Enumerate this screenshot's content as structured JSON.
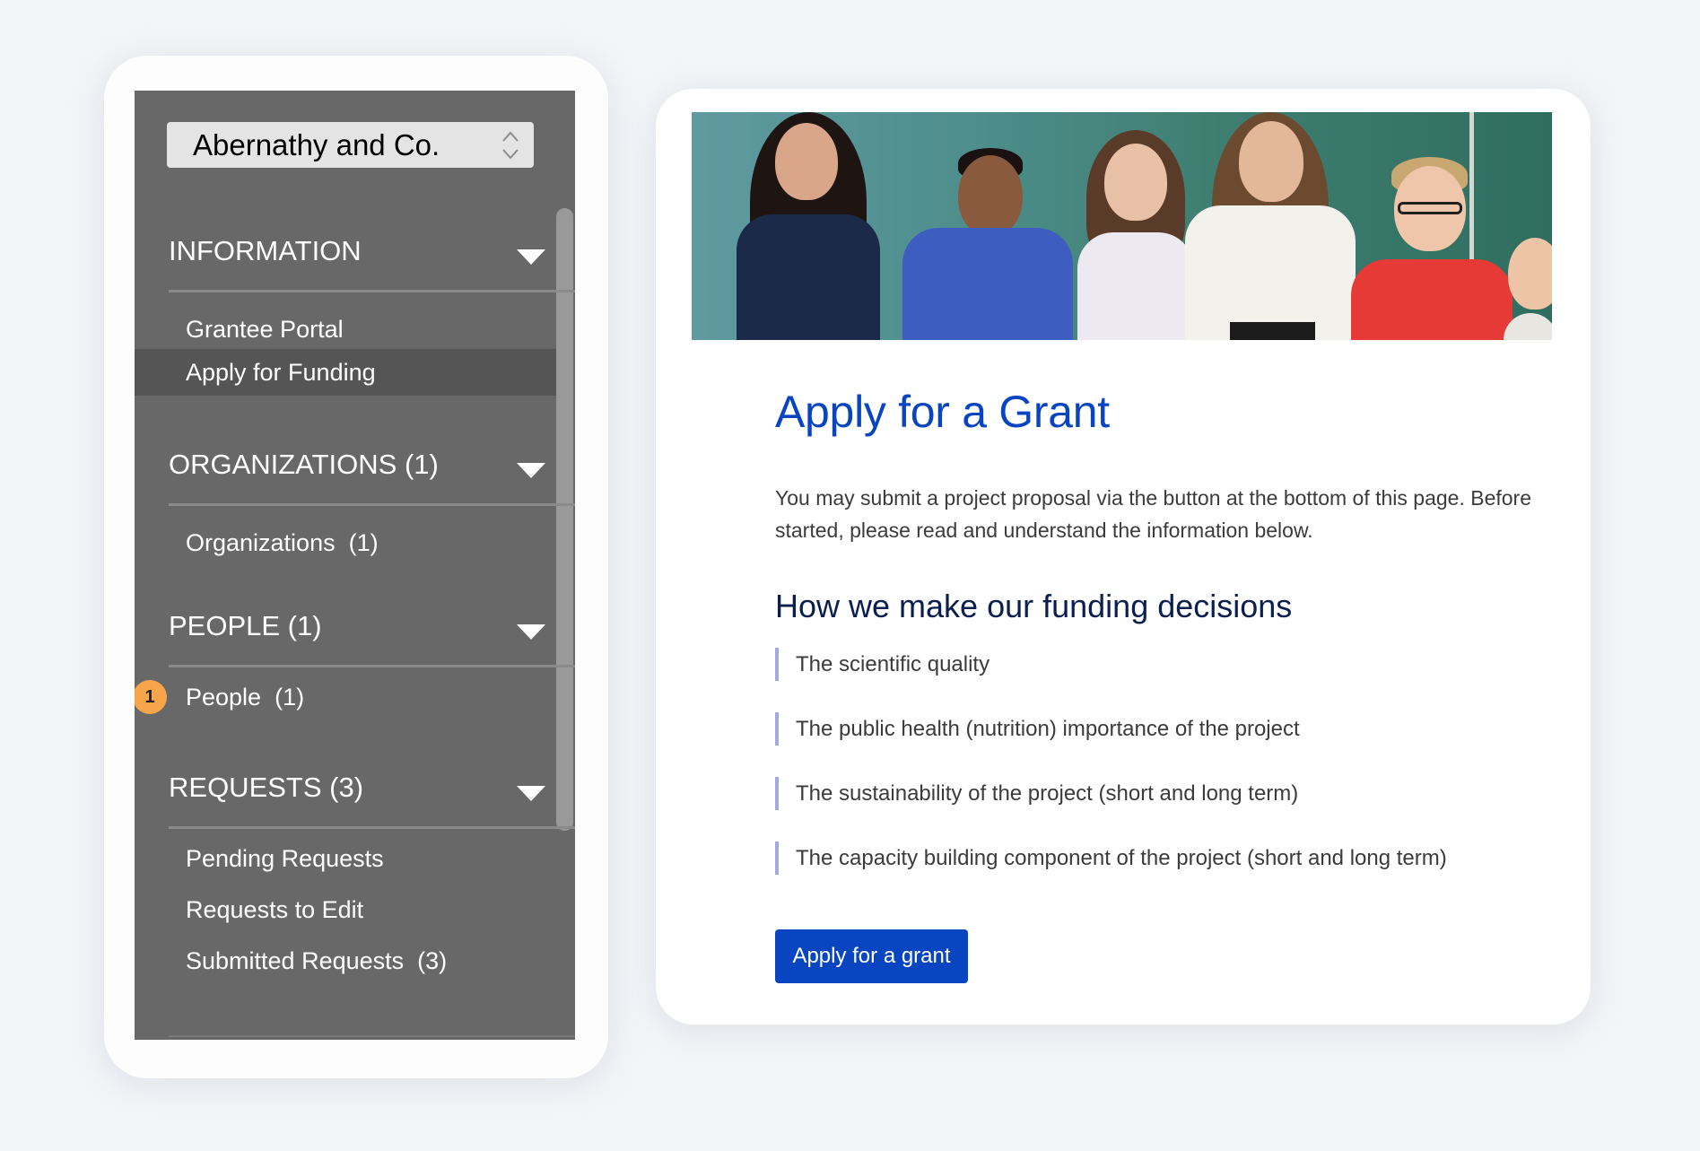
{
  "sidebar": {
    "org_selector": {
      "value": "Abernathy and Co.",
      "icon": "up-down-chevron-icon"
    },
    "sections": [
      {
        "title": "INFORMATION",
        "items": [
          {
            "label": "Grantee Portal",
            "active": false
          },
          {
            "label": "Apply for Funding",
            "active": true
          }
        ]
      },
      {
        "title": "ORGANIZATIONS (1)",
        "items": [
          {
            "label": "Organizations  (1)",
            "active": false
          }
        ]
      },
      {
        "title": "PEOPLE (1)",
        "items": [
          {
            "label": "People  (1)",
            "active": false,
            "badge": "1"
          }
        ]
      },
      {
        "title": "REQUESTS (3)",
        "items": [
          {
            "label": "Pending Requests",
            "active": false
          },
          {
            "label": "Requests to Edit",
            "active": false
          },
          {
            "label": "Submitted Requests  (3)",
            "active": false
          }
        ]
      }
    ]
  },
  "main": {
    "hero_image_alt": "Smiling students and teacher giving thumbs up in front of a chalkboard",
    "title": "Apply for a Grant",
    "intro_line1": "You may submit a project proposal via the button at the bottom of this page. Before",
    "intro_line2": "started, please read and understand the information below.",
    "subtitle": "How we make our funding decisions",
    "criteria": [
      "The scientific quality",
      "The public health (nutrition) importance of the project",
      "The sustainability of the project (short and long term)",
      "The capacity building component of the project (short and long term)"
    ],
    "apply_button": "Apply for a grant"
  },
  "colors": {
    "accent_blue": "#0a45c1",
    "heading_navy": "#0b1f4f",
    "sidebar_bg": "#686868",
    "sidebar_active": "#555555",
    "badge_orange": "#f6a54a",
    "criteria_bar": "#a4a9e0"
  }
}
